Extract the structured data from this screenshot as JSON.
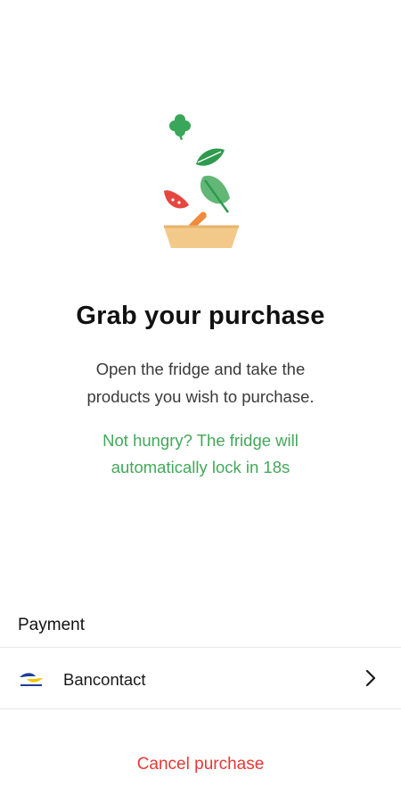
{
  "header": {
    "title": "Grab your purchase",
    "description_lines": [
      "Open the fridge and take the",
      "products you wish to purchase."
    ],
    "hint_lines": [
      "Not hungry? The fridge will",
      "automatically lock in 18s"
    ]
  },
  "payment": {
    "section_label": "Payment",
    "method_name": "Bancontact",
    "method_icon": "bancontact-logo"
  },
  "actions": {
    "cancel_label": "Cancel purchase"
  },
  "colors": {
    "accent_green": "#43a85a",
    "danger_red": "#e53935",
    "bowl": "#f3c98a",
    "leaf_green": "#3aa65a",
    "tomato": "#e5463f",
    "carrot": "#f08a3c"
  }
}
